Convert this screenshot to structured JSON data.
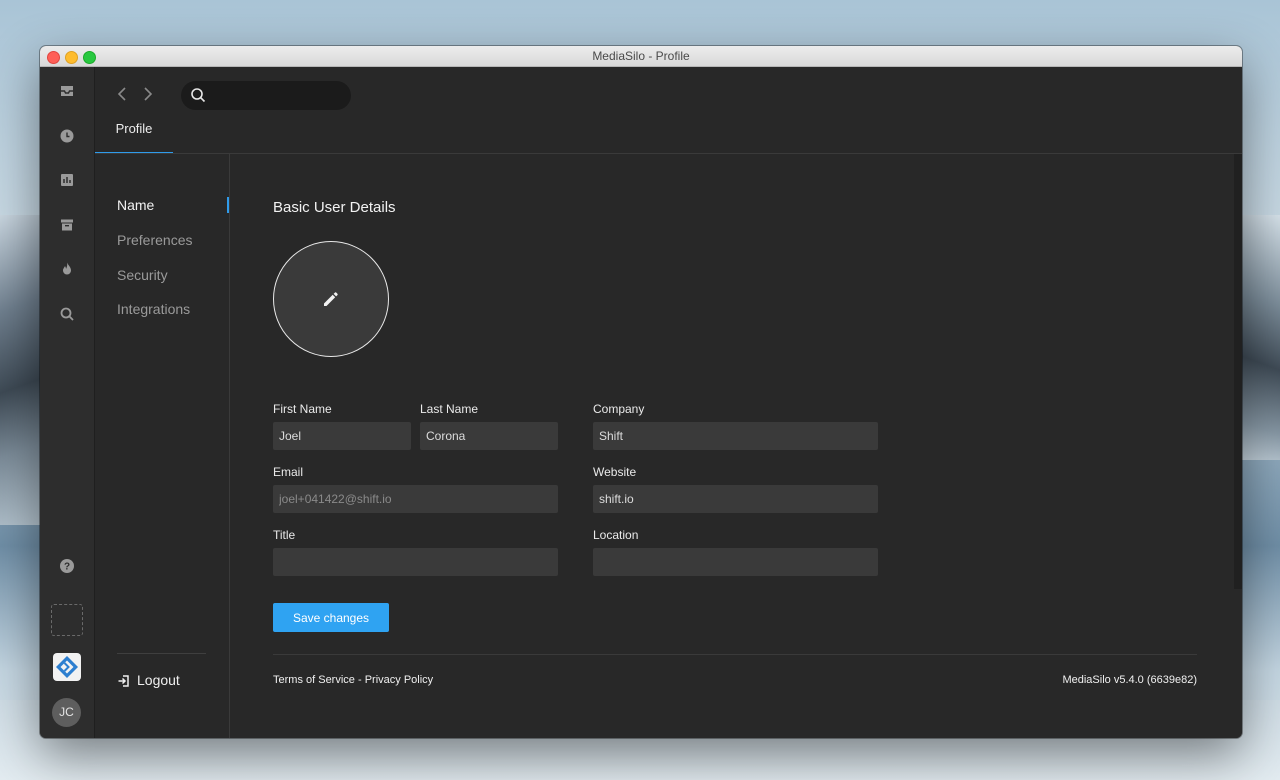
{
  "window": {
    "title": "MediaSilo - Profile"
  },
  "rail": {
    "icons": [
      "inbox-icon",
      "clock-icon",
      "chart-icon",
      "archive-icon",
      "flame-icon",
      "search-icon",
      "help-icon"
    ],
    "avatar_initials": "JC"
  },
  "header": {
    "search_placeholder": "",
    "tab": "Profile"
  },
  "subnav": {
    "items": [
      {
        "label": "Name"
      },
      {
        "label": "Preferences"
      },
      {
        "label": "Security"
      },
      {
        "label": "Integrations"
      }
    ],
    "logout": "Logout"
  },
  "form": {
    "heading": "Basic User Details",
    "first_name": {
      "label": "First Name",
      "value": "Joel"
    },
    "last_name": {
      "label": "Last Name",
      "value": "Corona"
    },
    "company": {
      "label": "Company",
      "value": "Shift"
    },
    "email": {
      "label": "Email",
      "value": "joel+041422@shift.io"
    },
    "website": {
      "label": "Website",
      "value": "shift.io"
    },
    "title": {
      "label": "Title",
      "value": ""
    },
    "location": {
      "label": "Location",
      "value": ""
    },
    "save_label": "Save changes"
  },
  "footer": {
    "terms": "Terms of Service",
    "separator": " - ",
    "privacy": "Privacy Policy",
    "version": "MediaSilo v5.4.0 (6639e82)"
  },
  "colors": {
    "accent": "#2f9bea",
    "button": "#2fa3f2",
    "background": "#282828"
  }
}
